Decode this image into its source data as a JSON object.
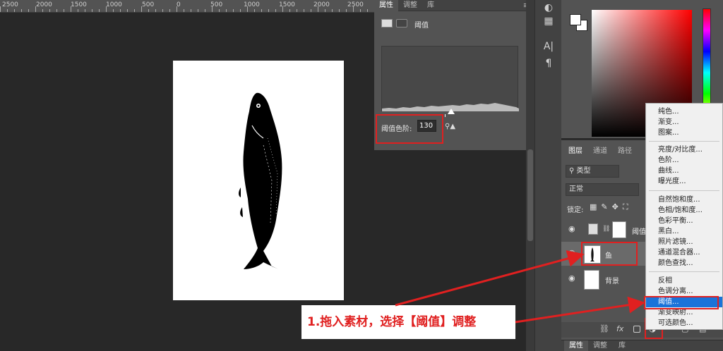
{
  "ruler": {
    "labels": [
      "2500",
      "2000",
      "1500",
      "1000",
      "500",
      "0",
      "500",
      "1000",
      "1500",
      "2000",
      "2500"
    ]
  },
  "properties": {
    "tabs": [
      "属性",
      "调整",
      "库"
    ],
    "adjustment_name": "阈值",
    "threshold_label": "阈值色阶:",
    "threshold_value": "130"
  },
  "tools": {
    "type_tool": "A|",
    "paragraph_tool": "¶"
  },
  "layers": {
    "tabs": [
      "图层",
      "通道",
      "路径"
    ],
    "filter_kind": "类型",
    "blend_mode": "正常",
    "lock_label": "锁定:",
    "items": [
      {
        "name": "阈值",
        "type": "adjustment"
      },
      {
        "name": "鱼",
        "type": "image"
      },
      {
        "name": "背景",
        "type": "background"
      }
    ],
    "footer": {
      "fx": "fx"
    }
  },
  "menu": {
    "groups": [
      [
        "纯色...",
        "渐变...",
        "图案..."
      ],
      [
        "亮度/对比度...",
        "色阶...",
        "曲线...",
        "曝光度..."
      ],
      [
        "自然饱和度...",
        "色相/饱和度...",
        "色彩平衡...",
        "黑白...",
        "照片滤镜...",
        "通道混合器...",
        "颜色查找..."
      ],
      [
        "反相",
        "色调分离...",
        "阈值...",
        "渐变映射...",
        "可选颜色..."
      ]
    ],
    "selected": "阈值..."
  },
  "annotation": {
    "text": "1.拖入素材，选择【阈值】调整"
  },
  "bottom_tabs": [
    "属性",
    "调整",
    "库"
  ],
  "colors": {
    "accent_red": "#e02020",
    "menu_highlight": "#1a73d9"
  }
}
